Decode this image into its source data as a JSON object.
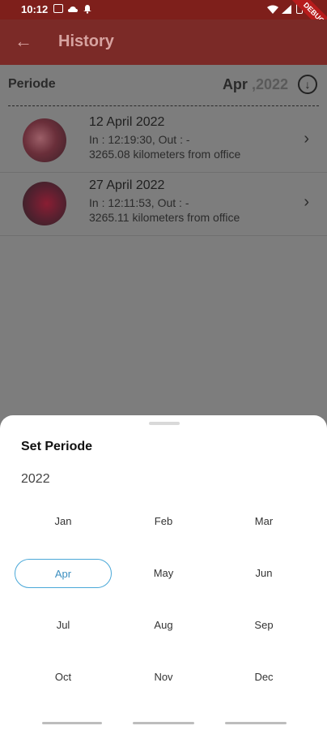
{
  "status_bar": {
    "time": "10:12",
    "icons": [
      "image-icon",
      "cloud-icon",
      "bell-icon",
      "wifi-icon",
      "signal-icon",
      "battery-icon"
    ],
    "debug_banner": "DEBUG"
  },
  "app_bar": {
    "title": "History",
    "back_icon": "arrow-left-icon"
  },
  "periode": {
    "label": "Periode",
    "month": "Apr",
    "year": ",2022",
    "download_icon": "download-circle-icon"
  },
  "history": [
    {
      "date": "12 April 2022",
      "times": "In : 12:19:30, Out : -",
      "distance": "3265.08 kilometers from office"
    },
    {
      "date": "27 April 2022",
      "times": "In : 12:11:53, Out : -",
      "distance": "3265.11 kilometers from office"
    }
  ],
  "sheet": {
    "title": "Set Periode",
    "year": "2022",
    "months": [
      "Jan",
      "Feb",
      "Mar",
      "Apr",
      "May",
      "Jun",
      "Jul",
      "Aug",
      "Sep",
      "Oct",
      "Nov",
      "Dec"
    ],
    "selected": "Apr"
  },
  "colors": {
    "statusbar": "#7e1f1b",
    "appbar": "#7b2a27",
    "accent": "#4aa8d8"
  }
}
